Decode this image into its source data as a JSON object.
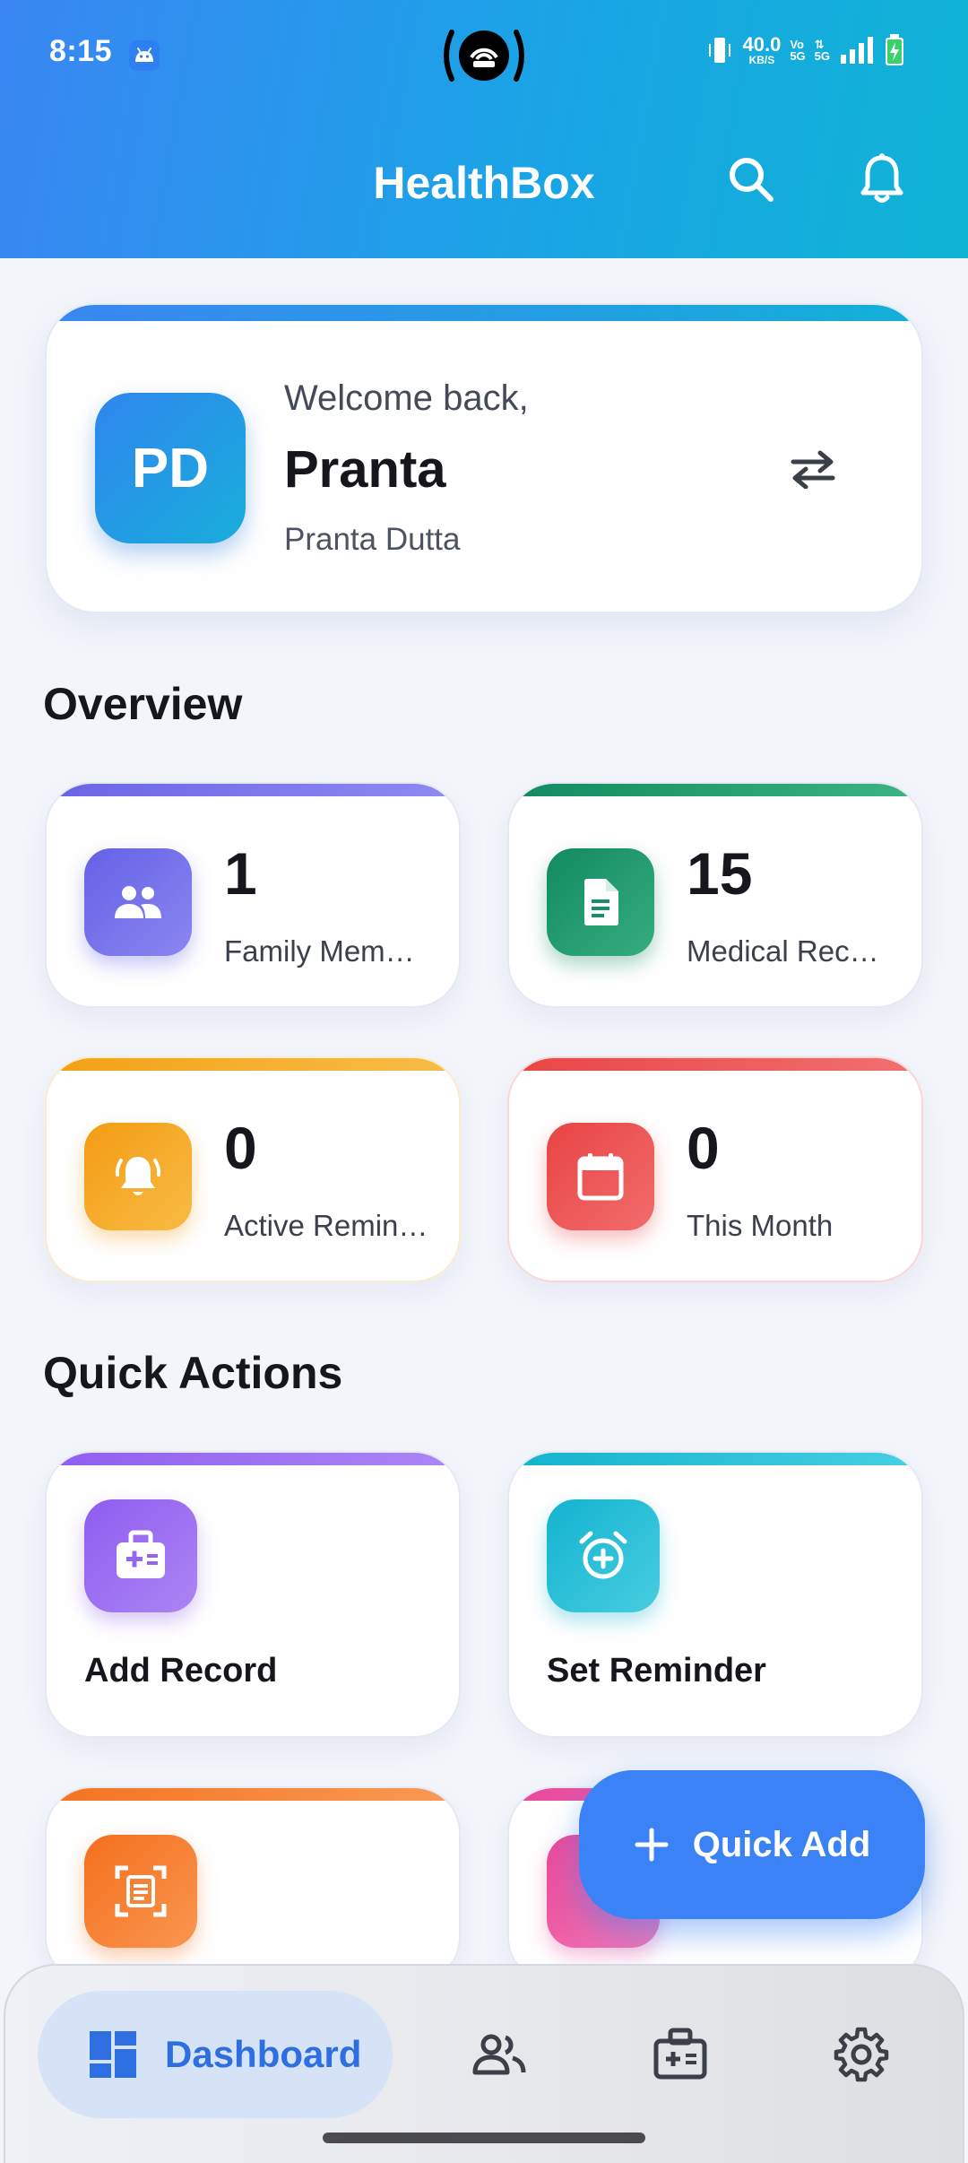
{
  "status_bar": {
    "time": "8:15",
    "net_speed_value": "40.0",
    "net_speed_unit": "KB/S",
    "vo_top": "Vo",
    "vo_bottom": "5G",
    "network": "5G"
  },
  "header": {
    "title": "HealthBox",
    "search_icon": "search-icon",
    "notifications_icon": "bell-icon",
    "gradient_start": "#3a86f3",
    "gradient_end": "#0fb3d4"
  },
  "welcome": {
    "initials": "PD",
    "greeting": "Welcome back,",
    "name": "Pranta",
    "full_name": "Pranta Dutta",
    "switch_icon": "swap-arrows-icon"
  },
  "overview": {
    "title": "Overview",
    "stats": [
      {
        "value": "1",
        "label": "Family Mem…",
        "icon": "people-icon",
        "color": "#6f6ae8"
      },
      {
        "value": "15",
        "label": "Medical Rec…",
        "icon": "document-icon",
        "color": "#179a6c"
      },
      {
        "value": "0",
        "label": "Active Remin…",
        "icon": "bell-ring-icon",
        "color": "#f5a51c"
      },
      {
        "value": "0",
        "label": "This Month",
        "icon": "calendar-icon",
        "color": "#ea4c4c"
      }
    ]
  },
  "quick_actions": {
    "title": "Quick Actions",
    "items": [
      {
        "label": "Add Record",
        "icon": "medical-kit-icon",
        "color": "#9466f0"
      },
      {
        "label": "Set Reminder",
        "icon": "alarm-add-icon",
        "color": "#1ab8d2"
      },
      {
        "label": "",
        "icon": "scan-document-icon",
        "color": "#f77a25"
      },
      {
        "label": "",
        "icon": "pink-action-icon",
        "color": "#ec4f9c"
      }
    ]
  },
  "fab": {
    "label": "Quick Add",
    "icon": "plus-icon"
  },
  "bottom_nav": {
    "items": [
      {
        "label": "Dashboard",
        "icon": "dashboard-icon",
        "active": true
      },
      {
        "label": "",
        "icon": "family-icon",
        "active": false
      },
      {
        "label": "",
        "icon": "records-icon",
        "active": false
      },
      {
        "label": "",
        "icon": "settings-icon",
        "active": false
      }
    ],
    "active_color": "#2d6ee0"
  }
}
